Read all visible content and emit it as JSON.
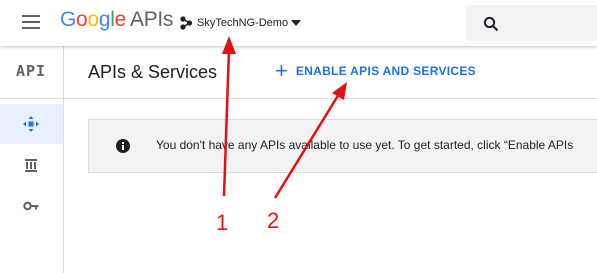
{
  "topbar": {
    "logo": {
      "letters": [
        "G",
        "o",
        "o",
        "g",
        "l",
        "e"
      ],
      "suffix": "APIs"
    },
    "project_name": "SkyTechNG-Demo",
    "icons": {
      "menu": "hamburger-menu-icon",
      "project": "project-nodes-icon",
      "dropdown": "caret-down-icon",
      "search": "search-icon"
    }
  },
  "rail": {
    "logo_text": "API",
    "items": [
      {
        "name": "dashboard",
        "icon": "dashboard-diamond-icon",
        "active": true
      },
      {
        "name": "library",
        "icon": "library-icon",
        "active": false
      },
      {
        "name": "credentials",
        "icon": "key-icon",
        "active": false
      }
    ]
  },
  "header": {
    "title": "APIs & Services",
    "enable_button": {
      "plus": "+",
      "label": "ENABLE APIS AND SERVICES"
    }
  },
  "banner": {
    "icon": "info-icon",
    "message": "You don't have any APIs available to use yet. To get started, click “Enable APIs"
  },
  "annotations": {
    "labels": [
      "1",
      "2"
    ],
    "color": "#e11111"
  },
  "colors": {
    "brand_blue": "#1a73e8",
    "active_rail": "#e8f0fe",
    "banner_bg": "#f1f3f4"
  }
}
